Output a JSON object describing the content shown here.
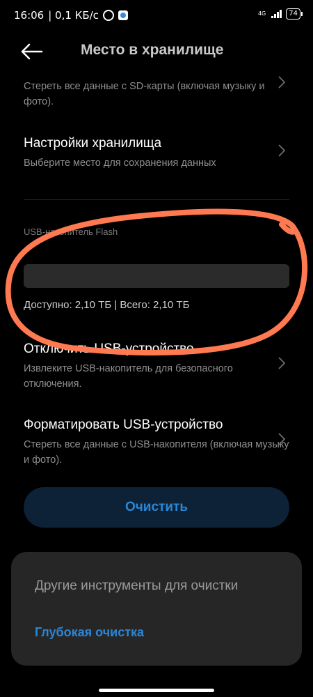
{
  "status_bar": {
    "time": "16:06",
    "speed": "| 0,1 КБ/с",
    "network": "4G",
    "battery": "74"
  },
  "header": {
    "title": "Место в хранилище"
  },
  "items": [
    {
      "title": "",
      "desc": "Стереть все данные с SD-карты (включая музыку и фото)."
    },
    {
      "title": "Настройки хранилища",
      "desc": "Выберите место для сохранения данных"
    },
    {
      "title": "Отключить USB-устройство",
      "desc": "Извлеките USB-накопитель для безопасного отключения."
    },
    {
      "title": "Форматировать USB-устройство",
      "desc": "Стереть все данные с USB-накопителя (включая музыку и фото)."
    }
  ],
  "usb": {
    "label": "USB-накопитель Flash",
    "usage_text": "Доступно: 2,10 ТБ | Всего: 2,10 ТБ",
    "used_fraction": 0
  },
  "clean_button": {
    "label": "Очистить"
  },
  "sheet": {
    "title": "Другие инструменты для очистки",
    "link": "Глубокая очистка"
  },
  "colors": {
    "background": "#000000",
    "accent": "#2a86d6",
    "annotation": "#ff7a50"
  },
  "icons": [
    "back-arrow-icon",
    "chevron-right-icon",
    "alarm-icon",
    "telegram-icon",
    "signal-icon",
    "battery-icon"
  ]
}
